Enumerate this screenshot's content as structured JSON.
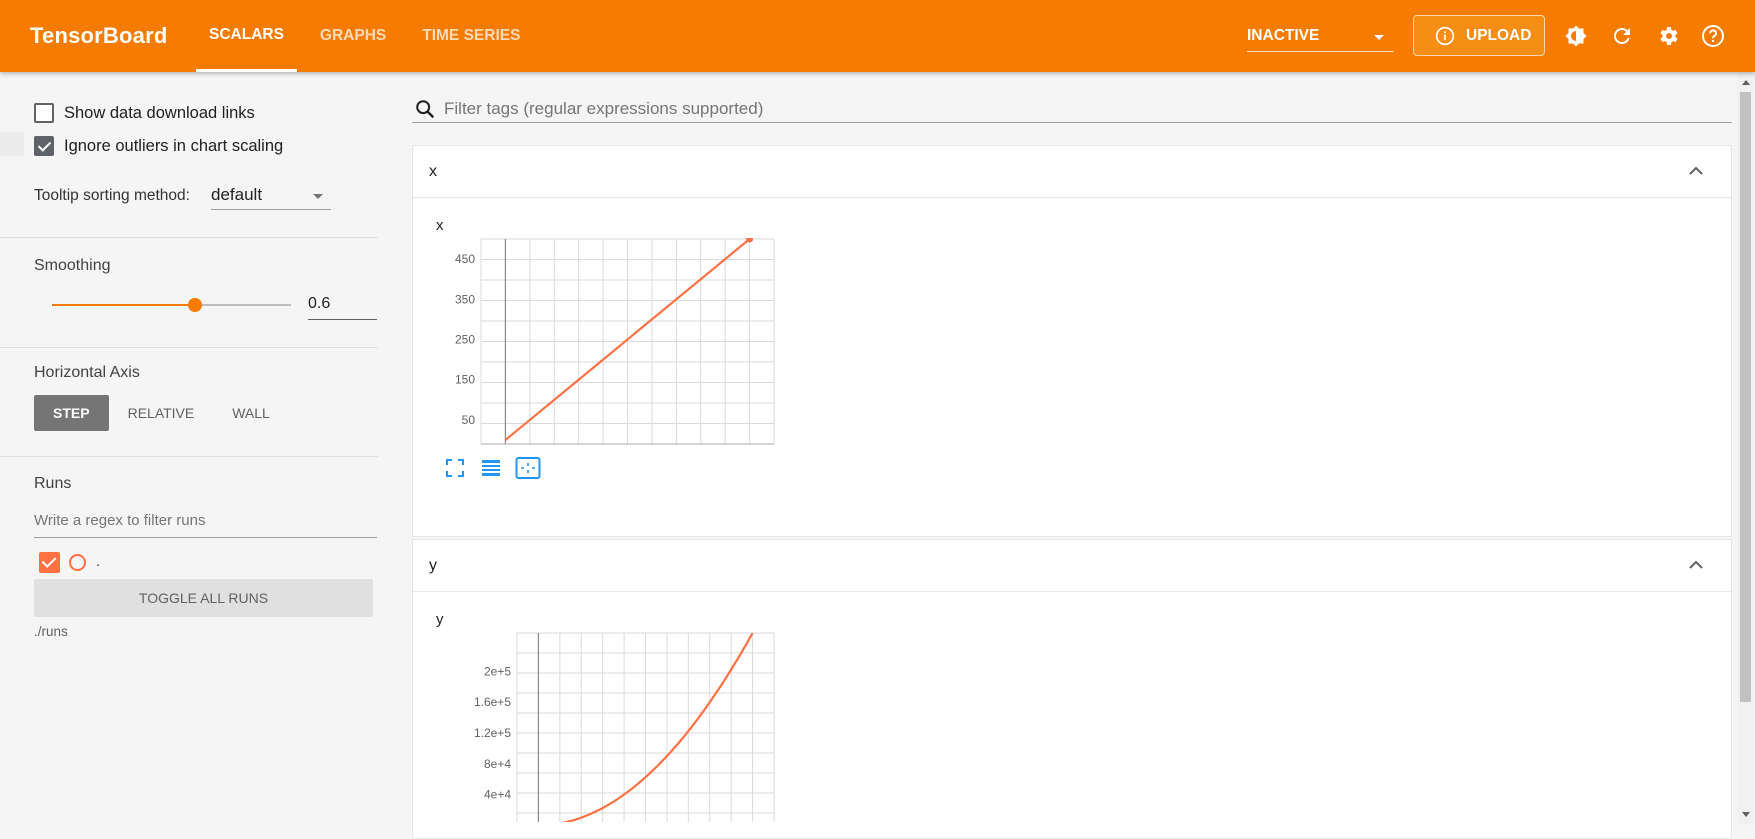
{
  "header": {
    "brand": "TensorBoard",
    "tabs": [
      "SCALARS",
      "GRAPHS",
      "TIME SERIES"
    ],
    "active_tab": "SCALARS",
    "status_select": "INACTIVE",
    "upload_label": "UPLOAD",
    "icons": [
      "brightness-icon",
      "refresh-icon",
      "settings-icon",
      "help-icon"
    ]
  },
  "sidebar": {
    "show_download_links": {
      "label": "Show data download links",
      "checked": false
    },
    "ignore_outliers": {
      "label": "Ignore outliers in chart scaling",
      "checked": true
    },
    "tooltip_label": "Tooltip sorting method:",
    "tooltip_value": "default",
    "smoothing_label": "Smoothing",
    "smoothing_value": "0.6",
    "smoothing_fraction": 0.6,
    "horizontal_axis_label": "Horizontal Axis",
    "axis_options": [
      "STEP",
      "RELATIVE",
      "WALL"
    ],
    "axis_selected": "STEP",
    "runs_label": "Runs",
    "runs_filter_placeholder": "Write a regex to filter runs",
    "run_name": ".",
    "toggle_all_label": "TOGGLE ALL RUNS",
    "run_path": "./runs"
  },
  "main": {
    "filter_placeholder": "Filter tags (regular expressions supported)",
    "cards": [
      {
        "header": "x",
        "chart_title": "x"
      },
      {
        "header": "y",
        "chart_title": "y"
      }
    ]
  },
  "colors": {
    "brand": "#f57c00",
    "series": "#ff7043",
    "tool": "#2196f3"
  },
  "chart_data": [
    {
      "type": "line",
      "title": "x",
      "x": [
        0,
        100,
        200,
        300,
        400,
        500
      ],
      "series": [
        {
          "values": [
            0,
            100,
            200,
            300,
            400,
            500
          ]
        }
      ],
      "x_ticks": [
        "0",
        "100",
        "200",
        "300",
        "400",
        "500"
      ],
      "y_ticks": [
        "50",
        "150",
        "250",
        "350",
        "450"
      ],
      "xlim": [
        -50,
        550
      ],
      "ylim": [
        -10,
        500
      ],
      "grid": true
    },
    {
      "type": "line",
      "title": "y",
      "x": [
        0,
        100,
        200,
        300,
        400,
        500
      ],
      "series": [
        {
          "values": [
            0,
            10000,
            40000,
            90000,
            160000,
            250000
          ]
        }
      ],
      "x_ticks": [],
      "y_ticks": [
        "4e+4",
        "8e+4",
        "1.2e+5",
        "1.6e+5",
        "2e+5"
      ],
      "xlim": [
        -50,
        550
      ],
      "ylim": [
        -10000,
        250000
      ],
      "grid": true
    }
  ]
}
